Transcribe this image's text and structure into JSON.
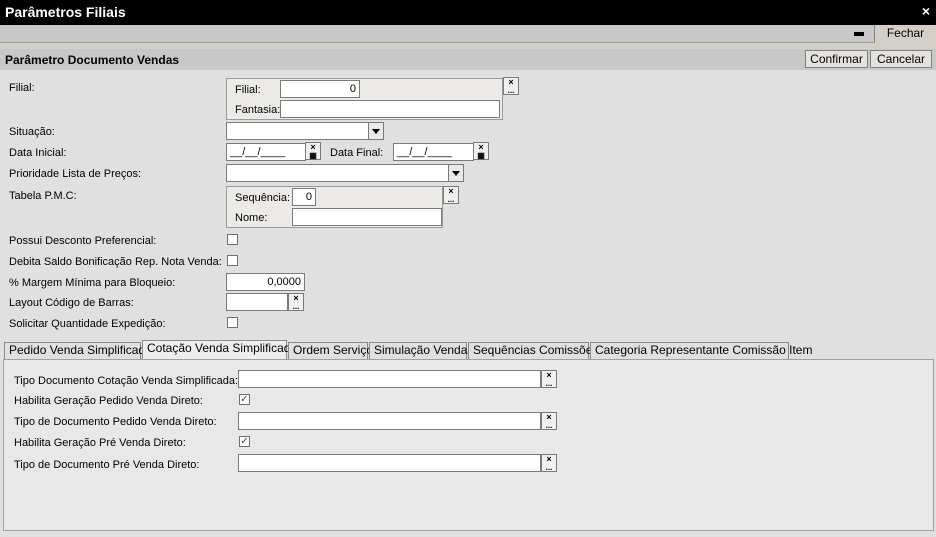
{
  "window": {
    "title": "Parâmetros Filiais",
    "close_glyph": "×"
  },
  "toolbar": {
    "close_label": "Fechar"
  },
  "section": {
    "title": "Parâmetro Documento Vendas",
    "confirm_label": "Confirmar",
    "cancel_label": "Cancelar"
  },
  "form": {
    "filial_label": "Filial:",
    "filial_group": {
      "filial_label": "Filial:",
      "filial_value": "0",
      "fantasia_label": "Fantasia:",
      "fantasia_value": ""
    },
    "situacao_label": "Situação:",
    "situacao_value": "",
    "data_inicial_label": "Data Inicial:",
    "data_inicial_value": "__/__/____",
    "data_final_label": "Data Final:",
    "data_final_value": "__/__/____",
    "prioridade_label": "Prioridade Lista de Preços:",
    "prioridade_value": "",
    "tabela_pmc_label": "Tabela P.M.C:",
    "tabela_group": {
      "sequencia_label": "Sequência:",
      "sequencia_value": "0",
      "nome_label": "Nome:",
      "nome_value": ""
    },
    "desconto_label": "Possui Desconto Preferencial:",
    "desconto_checked": false,
    "debita_label": "Debita Saldo Bonificação Rep. Nota Venda:",
    "debita_checked": false,
    "margem_label": "% Margem Mínima para Bloqueio:",
    "margem_value": "0,0000",
    "layout_label": "Layout Código de Barras:",
    "layout_value": "",
    "solicitar_label": "Solicitar Quantidade Expedição:",
    "solicitar_checked": false
  },
  "tabs": [
    {
      "label": "Pedido Venda Simplificado",
      "active": false
    },
    {
      "label": "Cotação Venda Simplificada",
      "active": true
    },
    {
      "label": "Ordem Serviço",
      "active": false
    },
    {
      "label": "Simulação Vendas",
      "active": false
    },
    {
      "label": "Sequências Comissões",
      "active": false
    },
    {
      "label": "Categoria Representante Comissão Item",
      "active": false
    }
  ],
  "tab_content": {
    "tipo_cotacao_label": "Tipo Documento Cotação Venda Simplificada:",
    "tipo_cotacao_value": "",
    "habilita_pedido_label": "Habilita Geração Pedido Venda Direto:",
    "habilita_pedido_checked": true,
    "tipo_pedido_label": "Tipo de Documento Pedido Venda Direto:",
    "tipo_pedido_value": "",
    "habilita_pre_label": "Habilita Geração Pré Venda Direto:",
    "habilita_pre_checked": true,
    "tipo_pre_label": "Tipo de Documento Pré Venda Direto:",
    "tipo_pre_value": ""
  },
  "icons": {
    "clear": "×",
    "lookup": "...",
    "calendar": "▦",
    "check": "✓"
  }
}
